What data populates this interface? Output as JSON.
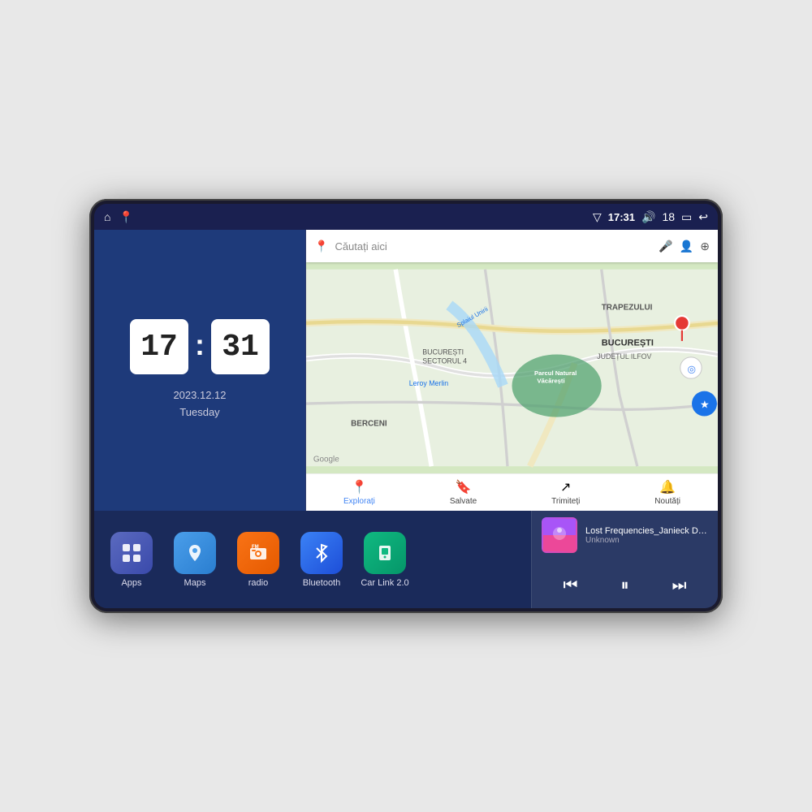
{
  "device": {
    "status_bar": {
      "left_icons": [
        "home-icon",
        "maps-pin-icon"
      ],
      "signal_icon": "▽",
      "time": "17:31",
      "volume_icon": "🔊",
      "battery_level": "18",
      "battery_icon": "🔋",
      "back_icon": "↩"
    },
    "clock": {
      "hours": "17",
      "minutes": "31",
      "date": "2023.12.12",
      "day": "Tuesday"
    },
    "map": {
      "search_placeholder": "Căutați aici",
      "nav_items": [
        {
          "label": "Explorați",
          "icon": "📍",
          "active": true
        },
        {
          "label": "Salvate",
          "icon": "🔖",
          "active": false
        },
        {
          "label": "Trimiteți",
          "icon": "↗",
          "active": false
        },
        {
          "label": "Noutăți",
          "icon": "🔔",
          "active": false
        }
      ],
      "location_labels": [
        "TRAPEZULUI",
        "BUCUREȘTI",
        "JUDEȚUL ILFOV",
        "BERCENI",
        "Parcul Natural Văcărești",
        "Leroy Merlin",
        "BUCUREȘTI SECTORUL 4",
        "Google"
      ]
    },
    "apps": [
      {
        "id": "apps",
        "label": "Apps",
        "icon_class": "icon-apps",
        "icon": "⊞"
      },
      {
        "id": "maps",
        "label": "Maps",
        "icon_class": "icon-maps",
        "icon": "📍"
      },
      {
        "id": "radio",
        "label": "radio",
        "icon_class": "icon-radio",
        "icon": "📻"
      },
      {
        "id": "bluetooth",
        "label": "Bluetooth",
        "icon_class": "icon-bluetooth",
        "icon": "🔵"
      },
      {
        "id": "carlink",
        "label": "Car Link 2.0",
        "icon_class": "icon-carlink",
        "icon": "📱"
      }
    ],
    "music": {
      "title": "Lost Frequencies_Janieck Devy-...",
      "artist": "Unknown",
      "prev_label": "⏮",
      "play_label": "⏸",
      "next_label": "⏭"
    }
  }
}
